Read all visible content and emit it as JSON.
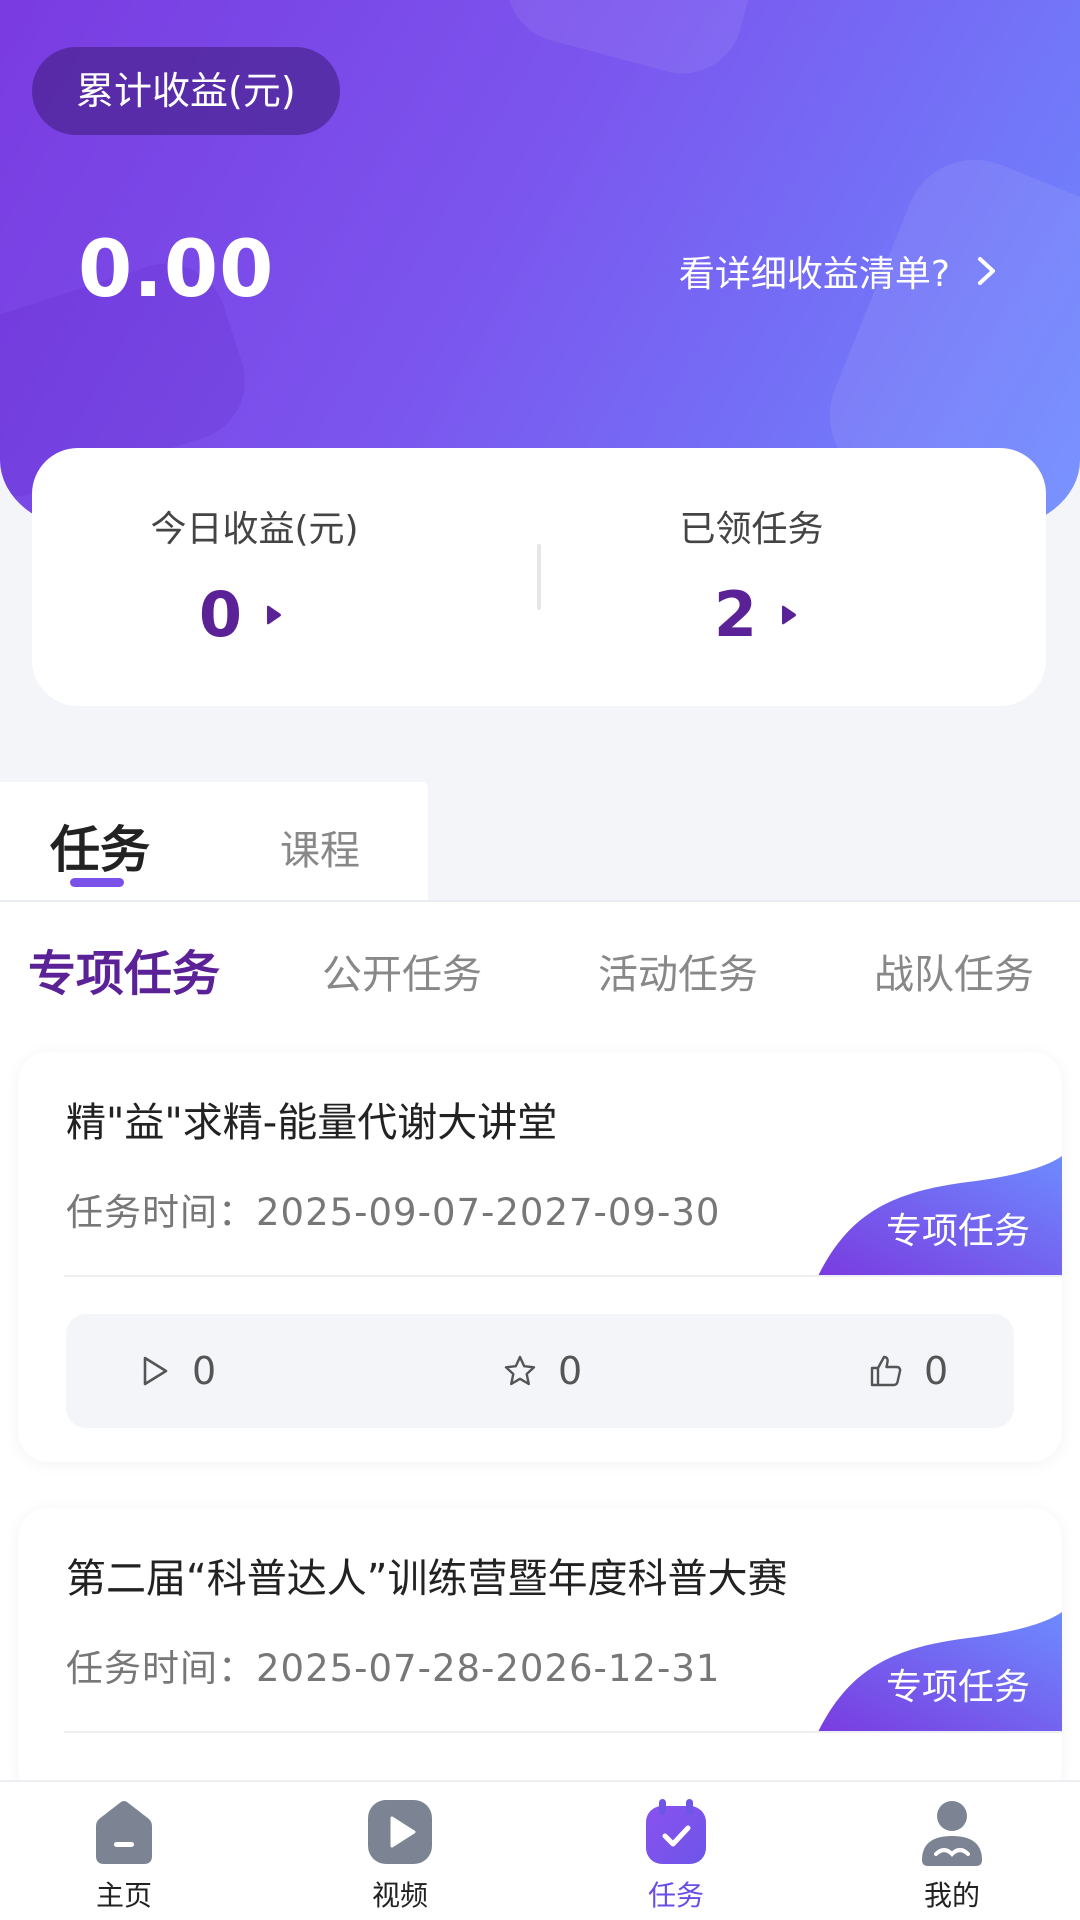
{
  "header": {
    "total_label": "累计收益(元)",
    "total_value": "0.00",
    "detail_link": "看详细收益清单?"
  },
  "stats": {
    "today_label": "今日收益(元)",
    "today_value": "0",
    "tasks_label": "已领任务",
    "tasks_value": "2"
  },
  "main_tabs": [
    {
      "label": "任务",
      "active": true
    },
    {
      "label": "课程",
      "active": false
    }
  ],
  "sub_tabs": [
    {
      "label": "专项任务",
      "active": true
    },
    {
      "label": "公开任务",
      "active": false
    },
    {
      "label": "活动任务",
      "active": false
    },
    {
      "label": "战队任务",
      "active": false
    }
  ],
  "tasks": [
    {
      "title": "精\"益\"求精-能量代谢大讲堂",
      "time": "任务时间：2025-09-07-2027-09-30",
      "tag": "专项任务",
      "plays": "0",
      "favorites": "0",
      "likes": "0"
    },
    {
      "title": "第二届“科普达人”训练营暨年度科普大赛",
      "time": "任务时间：2025-07-28-2026-12-31",
      "tag": "专项任务"
    }
  ],
  "bottom_nav": [
    {
      "label": "主页",
      "icon": "home-icon",
      "active": false
    },
    {
      "label": "视频",
      "icon": "video-icon",
      "active": false
    },
    {
      "label": "任务",
      "icon": "task-icon",
      "active": true
    },
    {
      "label": "我的",
      "icon": "profile-icon",
      "active": false
    }
  ],
  "colors": {
    "accent_purple": "#5b2196",
    "header_start": "#7a3be0",
    "header_end": "#6d8bff",
    "active_nav": "#6a4de6"
  }
}
